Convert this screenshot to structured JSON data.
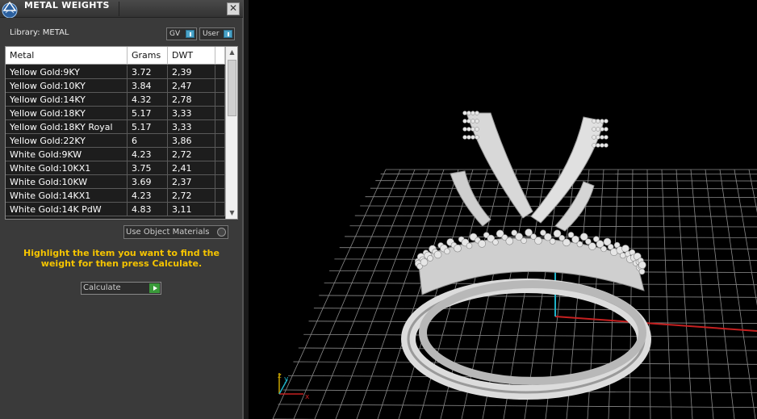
{
  "panel": {
    "title": "METAL WEIGHTS",
    "close_label": "✕",
    "library_label": "Library: METAL",
    "toggle_gv": "GV",
    "toggle_user": "User",
    "use_object_materials": "Use Object Materials",
    "hint": "Highlight the item you want to find the weight for then press Calculate.",
    "calculate_label": "Calculate"
  },
  "table": {
    "headers": [
      "Metal",
      "Grams",
      "DWT"
    ],
    "rows": [
      {
        "metal": "Yellow Gold:9KY",
        "grams": "3.72",
        "dwt": "2,39"
      },
      {
        "metal": "Yellow Gold:10KY",
        "grams": "3.84",
        "dwt": "2,47"
      },
      {
        "metal": "Yellow Gold:14KY",
        "grams": "4.32",
        "dwt": "2,78"
      },
      {
        "metal": "Yellow Gold:18KY",
        "grams": "5.17",
        "dwt": "3,33"
      },
      {
        "metal": "Yellow Gold:18KY Royal",
        "grams": "5.17",
        "dwt": "3,33"
      },
      {
        "metal": "Yellow Gold:22KY",
        "grams": "6",
        "dwt": "3,86"
      },
      {
        "metal": "White Gold:9KW",
        "grams": "4.23",
        "dwt": "2,72"
      },
      {
        "metal": "White Gold:10KX1",
        "grams": "3.75",
        "dwt": "2,41"
      },
      {
        "metal": "White Gold:10KW",
        "grams": "3.69",
        "dwt": "2,37"
      },
      {
        "metal": "White Gold:14KX1",
        "grams": "4.23",
        "dwt": "2,72"
      },
      {
        "metal": "White Gold:14K PdW",
        "grams": "4.83",
        "dwt": "3,11"
      }
    ]
  },
  "viewport": {
    "axis_x": "x",
    "axis_y": "y",
    "axis_z": "z"
  },
  "colors": {
    "hint": "#f5c400",
    "grid": "#8a8a8a",
    "x_axis": "#c62020",
    "y_axis": "#1fb2c8"
  }
}
